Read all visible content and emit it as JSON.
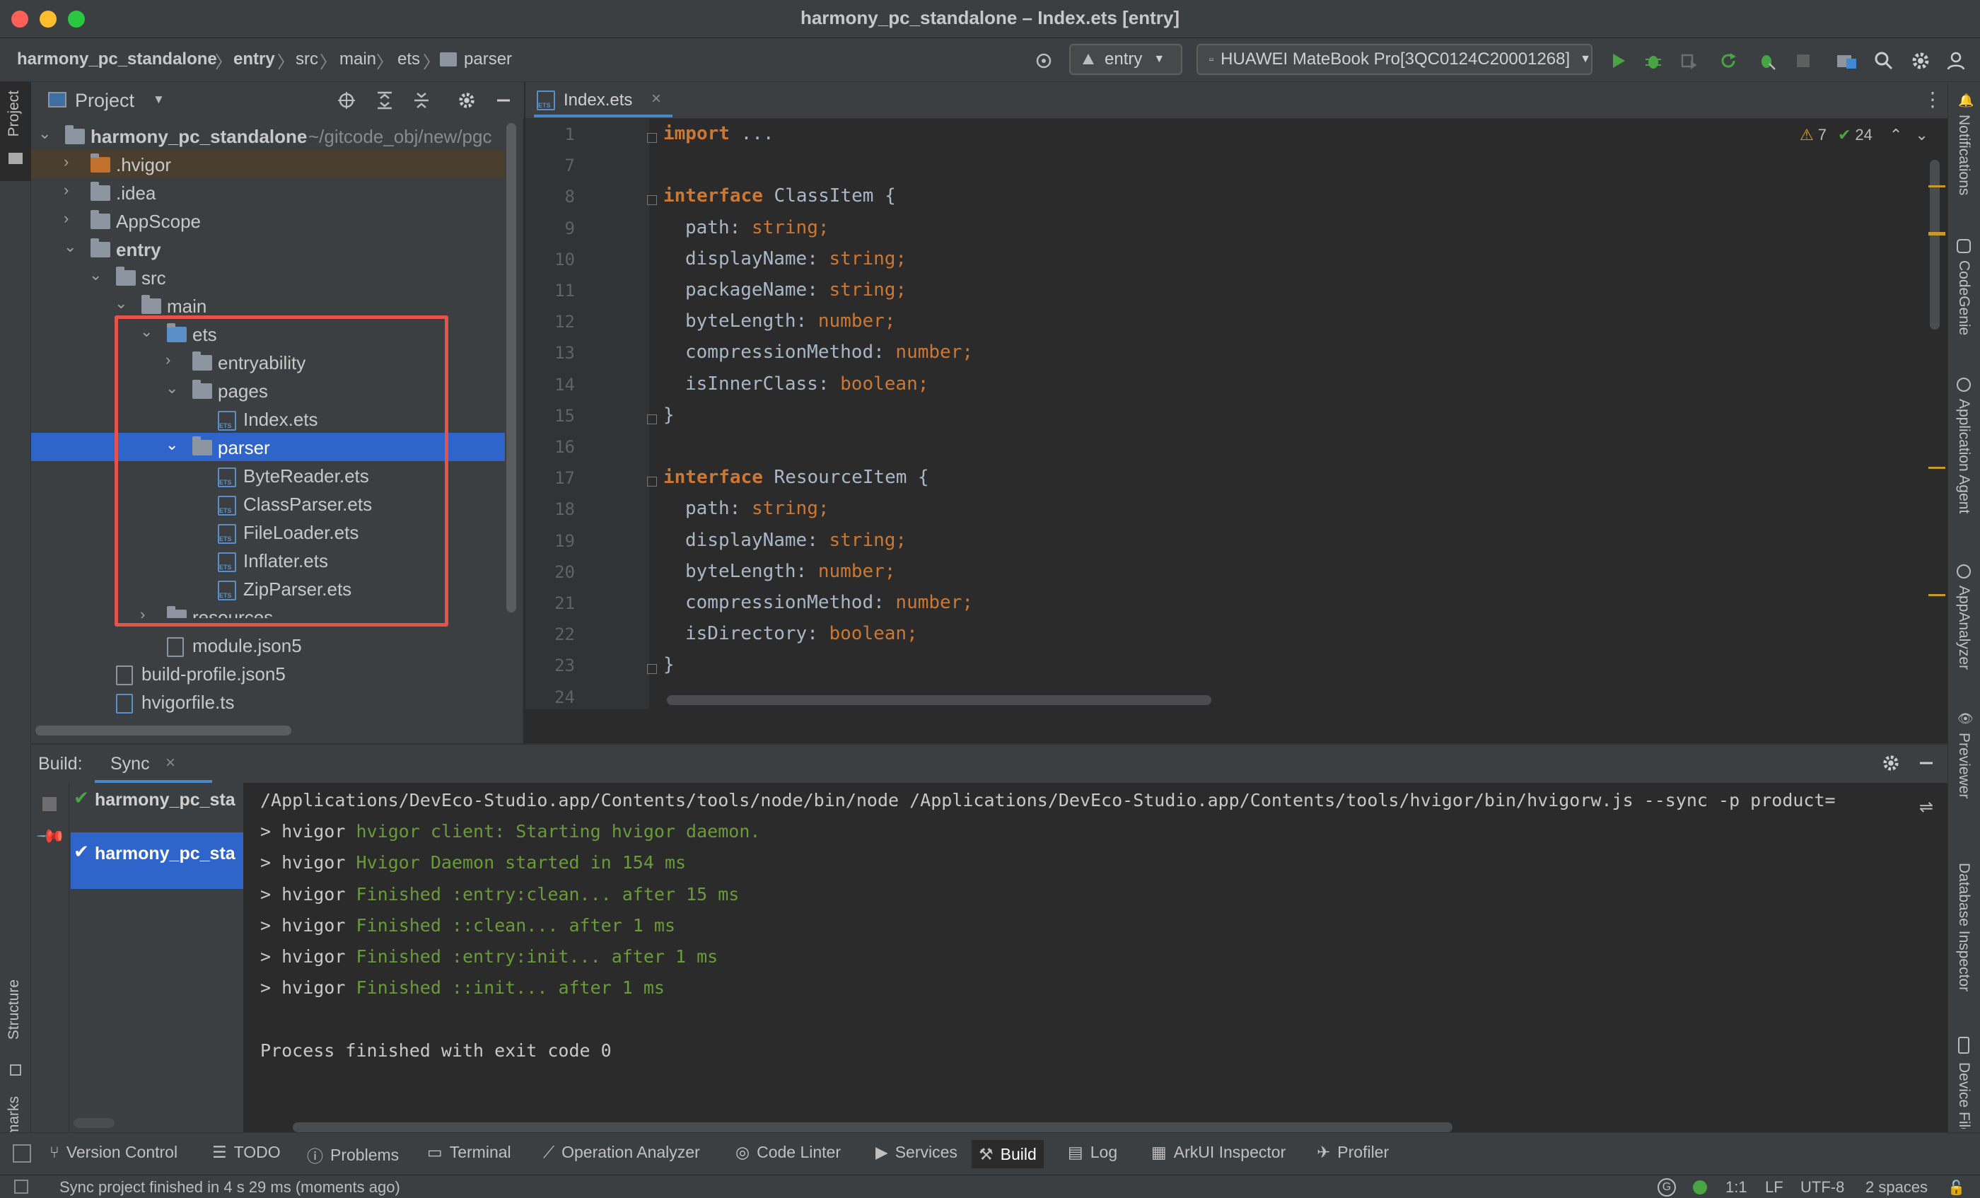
{
  "window": {
    "title": "harmony_pc_standalone – Index.ets [entry]"
  },
  "navbar": {
    "breadcrumb": [
      "harmony_pc_standalone",
      "entry",
      "src",
      "main",
      "ets",
      "parser"
    ],
    "module_select": "entry",
    "device_select": "HUAWEI MateBook Pro[3QC0124C20001268]"
  },
  "project_panel": {
    "title": "Project",
    "root_name": "harmony_pc_standalone",
    "root_path": "~/gitcode_obj/new/pgc",
    "items": [
      {
        "label": "harmony_pc_standalone"
      },
      {
        "label": ".hvigor"
      },
      {
        "label": ".idea"
      },
      {
        "label": "AppScope"
      },
      {
        "label": "entry"
      },
      {
        "label": "src"
      },
      {
        "label": "main"
      },
      {
        "label": "ets"
      },
      {
        "label": "entryability"
      },
      {
        "label": "pages"
      },
      {
        "label": "Index.ets"
      },
      {
        "label": "parser"
      },
      {
        "label": "ByteReader.ets"
      },
      {
        "label": "ClassParser.ets"
      },
      {
        "label": "FileLoader.ets"
      },
      {
        "label": "Inflater.ets"
      },
      {
        "label": "ZipParser.ets"
      },
      {
        "label": "resources"
      },
      {
        "label": "module.json5"
      },
      {
        "label": "build-profile.json5"
      },
      {
        "label": "hvigorfile.ts"
      }
    ]
  },
  "editor": {
    "tab_label": "Index.ets",
    "warnings": "7",
    "ok_count": "24",
    "line_numbers": [
      "1",
      "7",
      "8",
      "9",
      "10",
      "11",
      "12",
      "13",
      "14",
      "15",
      "16",
      "17",
      "18",
      "19",
      "20",
      "21",
      "22",
      "23",
      "24"
    ],
    "lines": [
      {
        "kw": "import",
        "rest": " ..."
      },
      {
        "kw": "",
        "rest": ""
      },
      {
        "kw": "interface",
        "rest": " ClassItem {"
      },
      {
        "prop": "path",
        "type": "string"
      },
      {
        "prop": "displayName",
        "type": "string"
      },
      {
        "prop": "packageName",
        "type": "string"
      },
      {
        "prop": "byteLength",
        "type": "number"
      },
      {
        "prop": "compressionMethod",
        "type": "number"
      },
      {
        "prop": "isInnerClass",
        "type": "boolean"
      },
      {
        "kw": "",
        "rest": "}"
      },
      {
        "kw": "",
        "rest": ""
      },
      {
        "kw": "interface",
        "rest": " ResourceItem {"
      },
      {
        "prop": "path",
        "type": "string"
      },
      {
        "prop": "displayName",
        "type": "string"
      },
      {
        "prop": "byteLength",
        "type": "number"
      },
      {
        "prop": "compressionMethod",
        "type": "number"
      },
      {
        "prop": "isDirectory",
        "type": "boolean"
      },
      {
        "kw": "",
        "rest": "}"
      },
      {
        "kw": "",
        "rest": ""
      }
    ]
  },
  "build_panel": {
    "label": "Build:",
    "tab": "Sync",
    "tree_items": [
      "harmony_pc_sta",
      "harmony_pc_sta"
    ],
    "console": [
      {
        "prefix": "",
        "text": "/Applications/DevEco-Studio.app/Contents/tools/node/bin/node /Applications/DevEco-Studio.app/Contents/tools/hvigor/bin/hvigorw.js --sync -p product="
      },
      {
        "prefix": "> hvigor ",
        "text": "hvigor client: Starting hvigor daemon."
      },
      {
        "prefix": "> hvigor ",
        "text": "Hvigor Daemon started in 154 ms"
      },
      {
        "prefix": "> hvigor ",
        "text": "Finished :entry:clean... after 15 ms"
      },
      {
        "prefix": "> hvigor ",
        "text": "Finished ::clean... after 1 ms"
      },
      {
        "prefix": "> hvigor ",
        "text": "Finished :entry:init... after 1 ms"
      },
      {
        "prefix": "> hvigor ",
        "text": "Finished ::init... after 1 ms"
      },
      {
        "prefix": "",
        "text": ""
      },
      {
        "prefix": "",
        "text": "Process finished with exit code 0"
      }
    ]
  },
  "left_strip": {
    "project": "Project",
    "structure": "Structure",
    "bookmarks": "Bookmarks"
  },
  "right_strip": {
    "notifications": "Notifications",
    "codegenie": "CodeGenie",
    "app_agent": "Application Agent",
    "appanalyzer": "AppAnalyzer",
    "previewer": "Previewer",
    "db_inspector": "Database Inspector",
    "device_file": "Device File"
  },
  "bottom_tools": {
    "version_control": "Version Control",
    "todo": "TODO",
    "problems": "Problems",
    "terminal": "Terminal",
    "operation_analyzer": "Operation Analyzer",
    "code_linter": "Code Linter",
    "services": "Services",
    "build": "Build",
    "log": "Log",
    "arkui_inspector": "ArkUI Inspector",
    "profiler": "Profiler"
  },
  "status": {
    "message": "Sync project finished in 4 s 29 ms (moments ago)",
    "position": "1:1",
    "line_sep": "LF",
    "encoding": "UTF-8",
    "indent": "2 spaces"
  },
  "colors": {
    "selection": "#2f65ca",
    "highlight_box": "#e5534b",
    "keyword": "#cc7832",
    "console_green": "#6a9b3a"
  }
}
